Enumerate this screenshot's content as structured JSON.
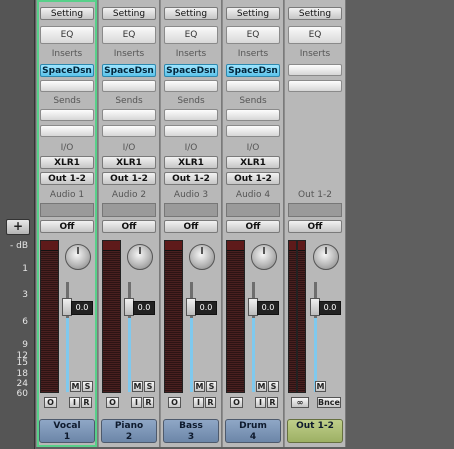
{
  "scale": {
    "add_button": "+",
    "ticks": [
      "- dB",
      "1",
      "3",
      "6",
      "9",
      "12",
      "15",
      "18",
      "24",
      "60"
    ]
  },
  "strips": [
    {
      "id": "vocal",
      "setting": "Setting",
      "eq": "EQ",
      "inserts_label": "Inserts",
      "insert": "SpaceDsn",
      "sends_label": "Sends",
      "io_label": "I/O",
      "input": "XLR1",
      "output": "Out 1-2",
      "track_label": "Audio 1",
      "automation": "Off",
      "fader_value": "0.0",
      "mute": "M",
      "solo": "S",
      "rec_o": "O",
      "rec_i": "I",
      "rec_r": "R",
      "name": "Vocal",
      "number": "1",
      "selected": true
    },
    {
      "id": "piano",
      "setting": "Setting",
      "eq": "EQ",
      "inserts_label": "Inserts",
      "insert": "SpaceDsn",
      "sends_label": "Sends",
      "io_label": "I/O",
      "input": "XLR1",
      "output": "Out 1-2",
      "track_label": "Audio 2",
      "automation": "Off",
      "fader_value": "0.0",
      "mute": "M",
      "solo": "S",
      "rec_o": "O",
      "rec_i": "I",
      "rec_r": "R",
      "name": "Piano",
      "number": "2",
      "selected": false
    },
    {
      "id": "bass",
      "setting": "Setting",
      "eq": "EQ",
      "inserts_label": "Inserts",
      "insert": "SpaceDsn",
      "sends_label": "Sends",
      "io_label": "I/O",
      "input": "XLR1",
      "output": "Out 1-2",
      "track_label": "Audio 3",
      "automation": "Off",
      "fader_value": "0.0",
      "mute": "M",
      "solo": "S",
      "rec_o": "O",
      "rec_i": "I",
      "rec_r": "R",
      "name": "Bass",
      "number": "3",
      "selected": false
    },
    {
      "id": "drum",
      "setting": "Setting",
      "eq": "EQ",
      "inserts_label": "Inserts",
      "insert": "SpaceDsn",
      "sends_label": "Sends",
      "io_label": "I/O",
      "input": "XLR1",
      "output": "Out 1-2",
      "track_label": "Audio 4",
      "automation": "Off",
      "fader_value": "0.0",
      "mute": "M",
      "solo": "S",
      "rec_o": "O",
      "rec_i": "I",
      "rec_r": "R",
      "name": "Drum",
      "number": "4",
      "selected": false
    },
    {
      "id": "output",
      "setting": "Setting",
      "eq": "EQ",
      "inserts_label": "Inserts",
      "sends_label": "",
      "io_label": "",
      "output_label": "Out 1-2",
      "automation": "Off",
      "fader_value": "0.0",
      "mute": "M",
      "link_icon": "link-icon",
      "bounce": "Bnce",
      "name": "Out 1-2",
      "selected": false
    }
  ],
  "colors": {
    "selected_border": "#58d08a",
    "insert_plugin": "#5cc3ea",
    "track_name_bg": "#6c86a8",
    "output_name_bg": "#9db064",
    "fader_fill": "#7fc9ee"
  }
}
